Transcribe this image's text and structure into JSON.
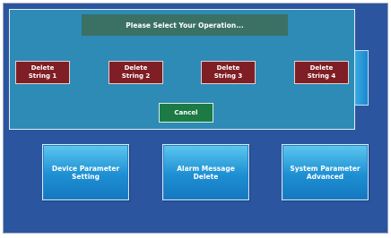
{
  "dialog": {
    "title": "Please Select Your Operation...",
    "delete_buttons": [
      {
        "label_line1": "Delete",
        "label_line2": "String 1"
      },
      {
        "label_line1": "Delete",
        "label_line2": "String 2"
      },
      {
        "label_line1": "Delete",
        "label_line2": "String 3"
      },
      {
        "label_line1": "Delete",
        "label_line2": "String 4"
      }
    ],
    "cancel_label": "Cancel"
  },
  "background_menu": {
    "buttons": [
      {
        "label_line1": "Device Parameter",
        "label_line2": "Setting"
      },
      {
        "label_line1": "Alarm Message",
        "label_line2": "Delete"
      },
      {
        "label_line1": "System Parameter",
        "label_line2": "Advanced"
      }
    ]
  },
  "colors": {
    "screen_bg": "#2c55a0",
    "dialog_bg": "#2d8bb6",
    "title_bar": "#3b7065",
    "delete_button": "#7f1e24",
    "cancel_button": "#1c7a45",
    "menu_button": "#1d8fd3"
  }
}
